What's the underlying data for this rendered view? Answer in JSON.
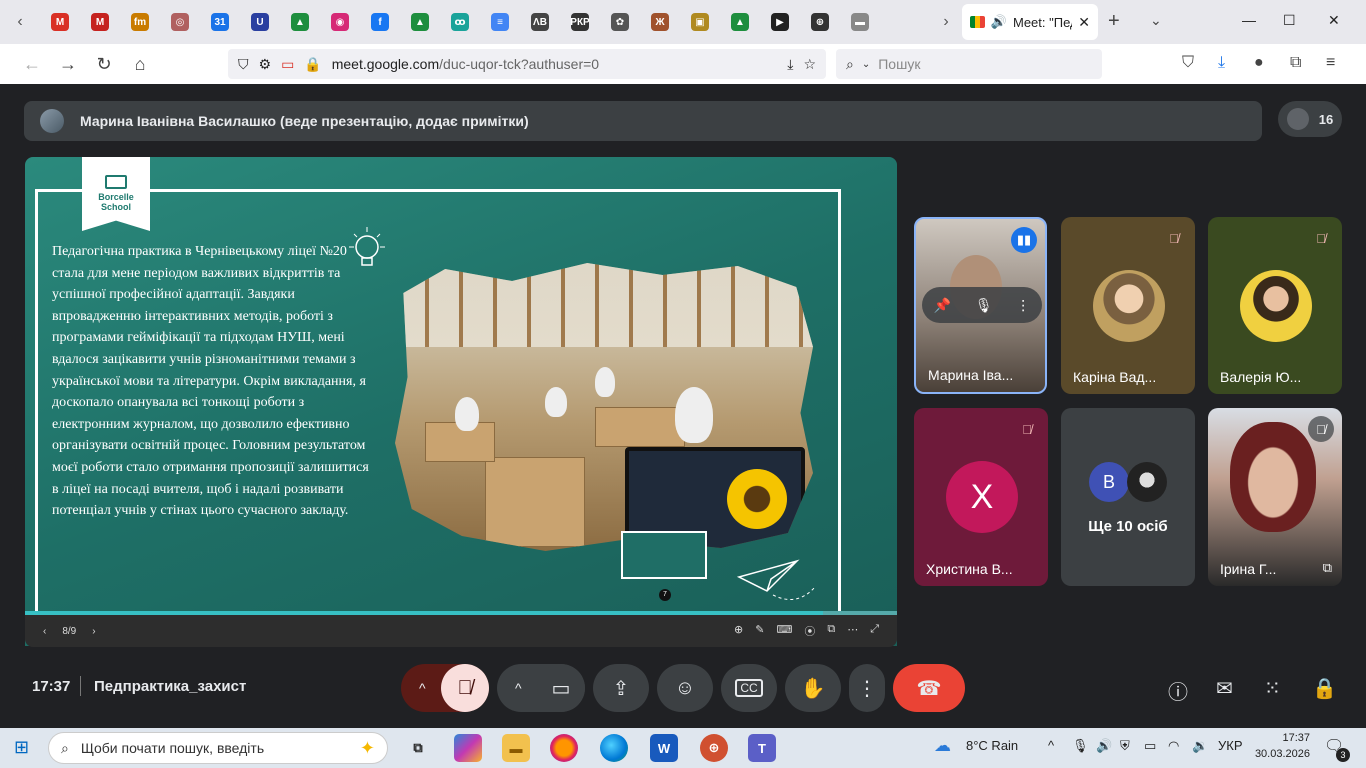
{
  "browser": {
    "pinned_tabs": [
      {
        "icon": "gmail-icon",
        "glyph": "M",
        "color": "#d93025"
      },
      {
        "icon": "gmail-icon",
        "glyph": "M",
        "color": "#c5221f"
      },
      {
        "icon": "fm-icon",
        "glyph": "fm",
        "color": "#c97b00"
      },
      {
        "icon": "seal-icon",
        "glyph": "◎",
        "color": "#b06060"
      },
      {
        "icon": "calendar-icon",
        "glyph": "31",
        "color": "#1a73e8"
      },
      {
        "icon": "u-icon",
        "glyph": "U",
        "color": "#2a3fa0"
      },
      {
        "icon": "drive-icon",
        "glyph": "▲",
        "color": "#1e8e3e"
      },
      {
        "icon": "instagram-icon",
        "glyph": "◉",
        "color": "#d62976"
      },
      {
        "icon": "facebook-icon",
        "glyph": "f",
        "color": "#1877f2"
      },
      {
        "icon": "drive-icon",
        "glyph": "▲",
        "color": "#1e8e3e"
      },
      {
        "icon": "go-icon",
        "glyph": "ꝏ",
        "color": "#1aa39a"
      },
      {
        "icon": "docs-icon",
        "glyph": "≡",
        "color": "#4285f4"
      },
      {
        "icon": "lv-icon",
        "glyph": "ΛВ",
        "color": "#444444"
      },
      {
        "icon": "pkp-icon",
        "glyph": "РКР",
        "color": "#333333"
      },
      {
        "icon": "chatgpt-icon",
        "glyph": "✿",
        "color": "#555555"
      },
      {
        "icon": "book-icon",
        "glyph": "Ж",
        "color": "#a0522d"
      },
      {
        "icon": "school-icon",
        "glyph": "▣",
        "color": "#b08a20"
      },
      {
        "icon": "drive-icon",
        "glyph": "▲",
        "color": "#1e8e3e"
      },
      {
        "icon": "media-icon",
        "glyph": "▶",
        "color": "#222222"
      },
      {
        "icon": "globe-icon",
        "glyph": "⊕",
        "color": "#333333"
      },
      {
        "icon": "flag-icon",
        "glyph": "▬",
        "color": "#888888"
      }
    ],
    "active_tab": {
      "title": "Meet: \"Пед"
    },
    "url": {
      "host": "meet.google.com",
      "path": "/duc-uqor-tck?authuser=0"
    },
    "search_placeholder": "Пошук"
  },
  "meet": {
    "presenter_banner": "Марина Іванівна Василашко (веде презентацію, додає примітки)",
    "participant_count": "16",
    "slide": {
      "logo_text": "Borcelle School",
      "body": "Педагогічна практика в Чернівецькому ліцеї №20 стала для мене періодом важливих відкриттів та успішної професійної адаптації. Завдяки впровадженню інтерактивних методів, роботі з програмами гейміфікації та підходам НУШ, мені вдалося зацікавити учнів різноманітними темами з української мови та літератури. Окрім викладання, я доскопало опанувала всі тонкощі роботи з електронним журналом, що дозволило ефективно організувати освітній процес. Головним результатом моєї роботи стало отримання пропозиції залишитися в ліцеї на посаді вчителя, щоб і надалі розвивати потенціал учнів у стінах цього сучасного закладу.",
      "thumb_number": "7",
      "page_indicator": "8/9",
      "progress": 0.915
    },
    "tiles": [
      {
        "name": "Марина Іва...",
        "muted": false
      },
      {
        "name": "Каріна Вад...",
        "muted": true
      },
      {
        "name": "Валерія Ю...",
        "muted": true
      },
      {
        "name": "Христина В...",
        "muted": true,
        "initial": "Х"
      },
      {
        "name": "Ще 10 осіб",
        "initial": "В"
      },
      {
        "name": "Ірина Г...",
        "muted": true
      }
    ],
    "time": "17:37",
    "meeting_title": "Педпрактика_захист"
  },
  "taskbar": {
    "search_placeholder": "Щоби почати пошук, введіть",
    "weather": "8°C  Rain",
    "lang": "УКР",
    "clock_time": "17:37",
    "clock_date": "30.03.2026",
    "notifications": "3"
  },
  "colors": {
    "meet_bg": "#202124",
    "surface": "#3c4043",
    "slide_teal": "#1f6e66",
    "end_call_red": "#ea4335",
    "mic_off_pink": "#f9dedc",
    "mute_badge_mauve": "#6e4b5e"
  }
}
